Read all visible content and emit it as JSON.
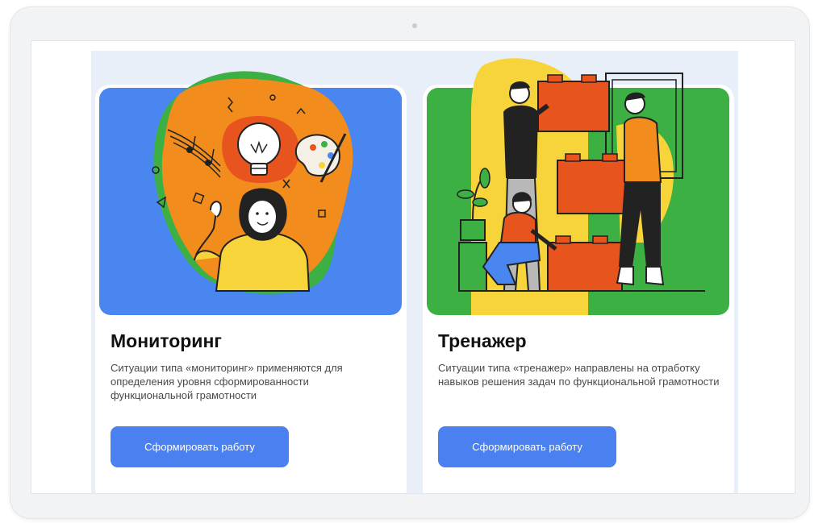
{
  "cards": [
    {
      "title": "Мониторинг",
      "description": "Ситуации типа «мониторинг» применяются для определения уровня сформированности функциональной грамотности",
      "button_label": "Сформировать работу",
      "background_color": "#4a86f0",
      "illustration": "person-with-lightbulb-icon"
    },
    {
      "title": "Тренажер",
      "description": "Ситуации типа «тренажер» направлены на отработку навыков решения задач по функциональной грамотности",
      "button_label": "Сформировать работу",
      "background_color": "#3db044",
      "illustration": "people-stacking-blocks-icon"
    }
  ],
  "colors": {
    "accent": "#4a80f0",
    "panel": "#e8eff9",
    "orange": "#f28c1c",
    "green": "#3db044",
    "yellow": "#f7d53a",
    "brick": "#e8541e"
  }
}
